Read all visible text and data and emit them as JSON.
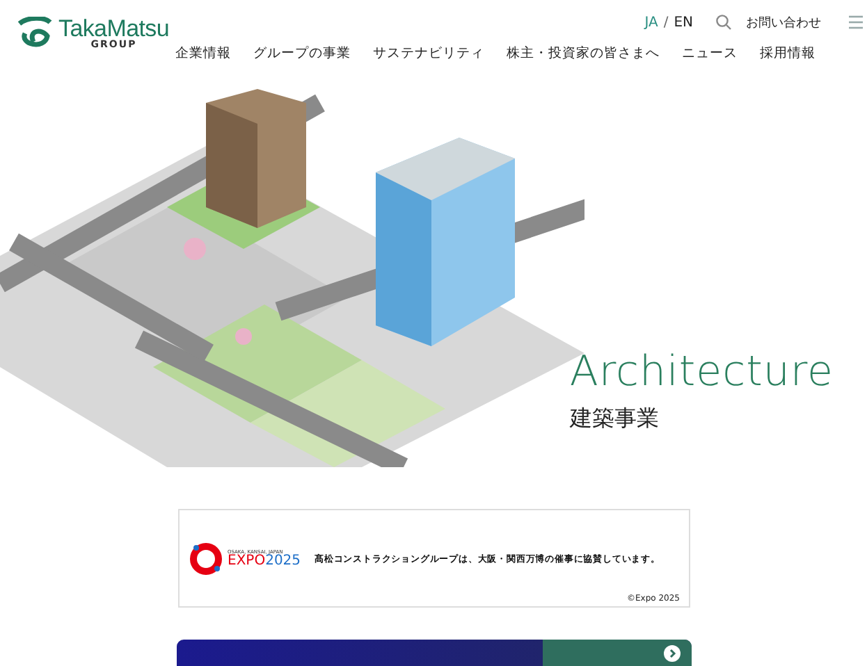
{
  "header": {
    "logo": {
      "name": "TakaMatsu",
      "sub": "GROUP"
    },
    "language_separator": "/",
    "languages": [
      {
        "label": "JA",
        "selected": true
      },
      {
        "label": "EN",
        "selected": false
      }
    ],
    "contact": "お問い合わせ",
    "nav": [
      "企業情報",
      "グループの事業",
      "サステナビリティ",
      "株主・投資家の皆さまへ",
      "ニュース",
      "採用情報"
    ]
  },
  "hero": {
    "title": "Architecture",
    "subtitle": "建築事業"
  },
  "expo_banner": {
    "logo_small": "OSAKA, KANSAI, JAPAN",
    "logo_expo": "EXPO",
    "logo_year": "2025",
    "message": "髙松コンストラクショングループは、大阪・関西万博の催事に協賛しています。",
    "credit": "©Expo 2025"
  }
}
